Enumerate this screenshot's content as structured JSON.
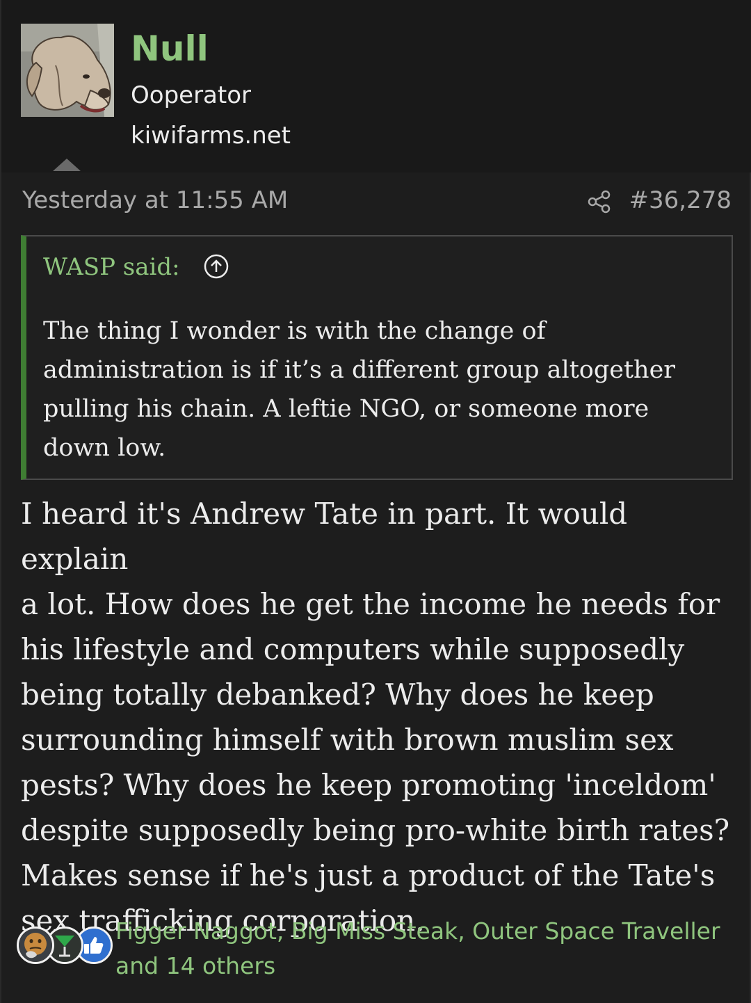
{
  "user": {
    "name": "Null",
    "title": "Ooperator",
    "site": "kiwifarms.net"
  },
  "post": {
    "date": "Yesterday at 11:55 AM",
    "number": "#36,278"
  },
  "quote": {
    "author_label": "WASP said:",
    "text": "The thing I wonder is with the change of\nadministration is if it’s a different group altogether\npulling his chain. A leftie NGO, or someone more\ndown low."
  },
  "message": {
    "text": "I heard it's Andrew Tate in part. It would explain\na lot. How does he get the income he needs for\nhis lifestyle and computers while supposedly\nbeing totally debanked? Why does he keep\nsurrounding himself with brown muslim sex\npests? Why does he keep promoting 'inceldom'\ndespite supposedly being pro-white birth rates?\nMakes sense if he's just a product of the Tate's\nsex trafficking corporation."
  },
  "reactions": {
    "names": "Figger Naggot, Big Miss Steak, Outer Space Traveller and 14 others",
    "icons": [
      "thinking-face-icon",
      "cocktail-glass-icon",
      "thumbs-up-icon"
    ]
  },
  "colors": {
    "accent_green": "#8fc57e",
    "quote_bar": "#3f7d33",
    "background": "#1d1d1d"
  }
}
